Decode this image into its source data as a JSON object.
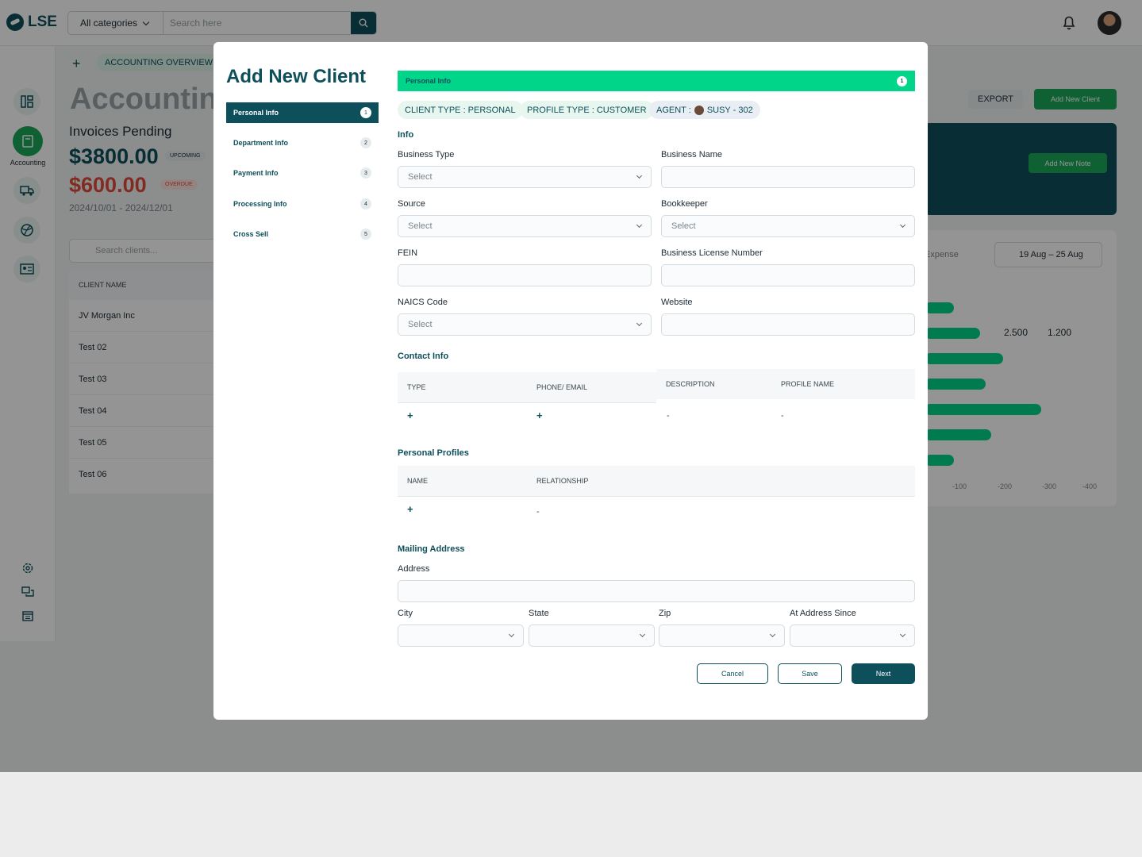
{
  "topbar": {
    "logo": "LSE",
    "category": "All categories",
    "search_placeholder": "Search here"
  },
  "sidebar": {
    "accounting_label": "Accounting"
  },
  "background": {
    "breadcrumb": "ACCOUNTING OVERVIEW",
    "page_title": "Accountin",
    "invoices_pending": "Invoices Pending",
    "upcoming_amount": "$3800.00",
    "upcoming_badge": "UPCOMING",
    "overdue_amount": "$600.00",
    "overdue_badge": "OVERDUE",
    "date_range": "2024/10/01 - 2024/12/01",
    "search_clients": "Search clients...",
    "client_column": "CLIENT NAME",
    "clients": [
      "JV Morgan Inc",
      "Test 02",
      "Test 03",
      "Test 04",
      "Test 05",
      "Test 06"
    ],
    "export": "EXPORT",
    "add_new_client": "Add New Client",
    "add_new_note": "Add New Note",
    "expense": "Expense",
    "chart_date": "19 Aug – 25 Aug",
    "legend_a": "2.500",
    "legend_b": "1.200",
    "axis_ticks": [
      "-100",
      "-200",
      "-300",
      "-400"
    ]
  },
  "modal": {
    "title": "Add New Client",
    "steps": [
      {
        "label": "Personal Info",
        "num": "1"
      },
      {
        "label": "Department  Info",
        "num": "2"
      },
      {
        "label": "Payment Info",
        "num": "3"
      },
      {
        "label": "Processing Info",
        "num": "4"
      },
      {
        "label": "Cross Sell",
        "num": "5"
      }
    ],
    "bar_label": "Personal Info",
    "bar_num": "1",
    "chips": {
      "client_type": "CLIENT TYPE : PERSONAL",
      "profile_type": "PROFILE TYPE : CUSTOMER",
      "agent_prefix": "AGENT :",
      "agent_name": "SUSY - 302"
    },
    "info": {
      "heading": "Info",
      "business_type": "Business Type",
      "business_name": "Business Name",
      "source": "Source",
      "bookkeeper": "Bookkeeper",
      "fein": "FEIN",
      "license": "Business License Number",
      "naics": "NAICS Code",
      "website": "Website",
      "select": "Select"
    },
    "contact": {
      "heading": "Contact Info",
      "columns": [
        "TYPE",
        "PHONE/ EMAIL",
        "DESCRIPTION",
        "PROFILE NAME"
      ],
      "plus": "+",
      "dash": "-"
    },
    "profiles": {
      "heading": "Personal Profiles",
      "columns": [
        "NAME",
        "RELATIONSHIP"
      ],
      "plus": "+",
      "dash": "-"
    },
    "mailing": {
      "heading": "Mailing Address",
      "address": "Address",
      "city": "City",
      "state": "State",
      "zip": "Zip",
      "since": "At Address Since"
    },
    "buttons": {
      "cancel": "Cancel",
      "save": "Save",
      "next": "Next"
    }
  },
  "colors": {
    "primary": "#0e4f5c",
    "accent": "#00d589",
    "overdue": "#e04a3b"
  }
}
